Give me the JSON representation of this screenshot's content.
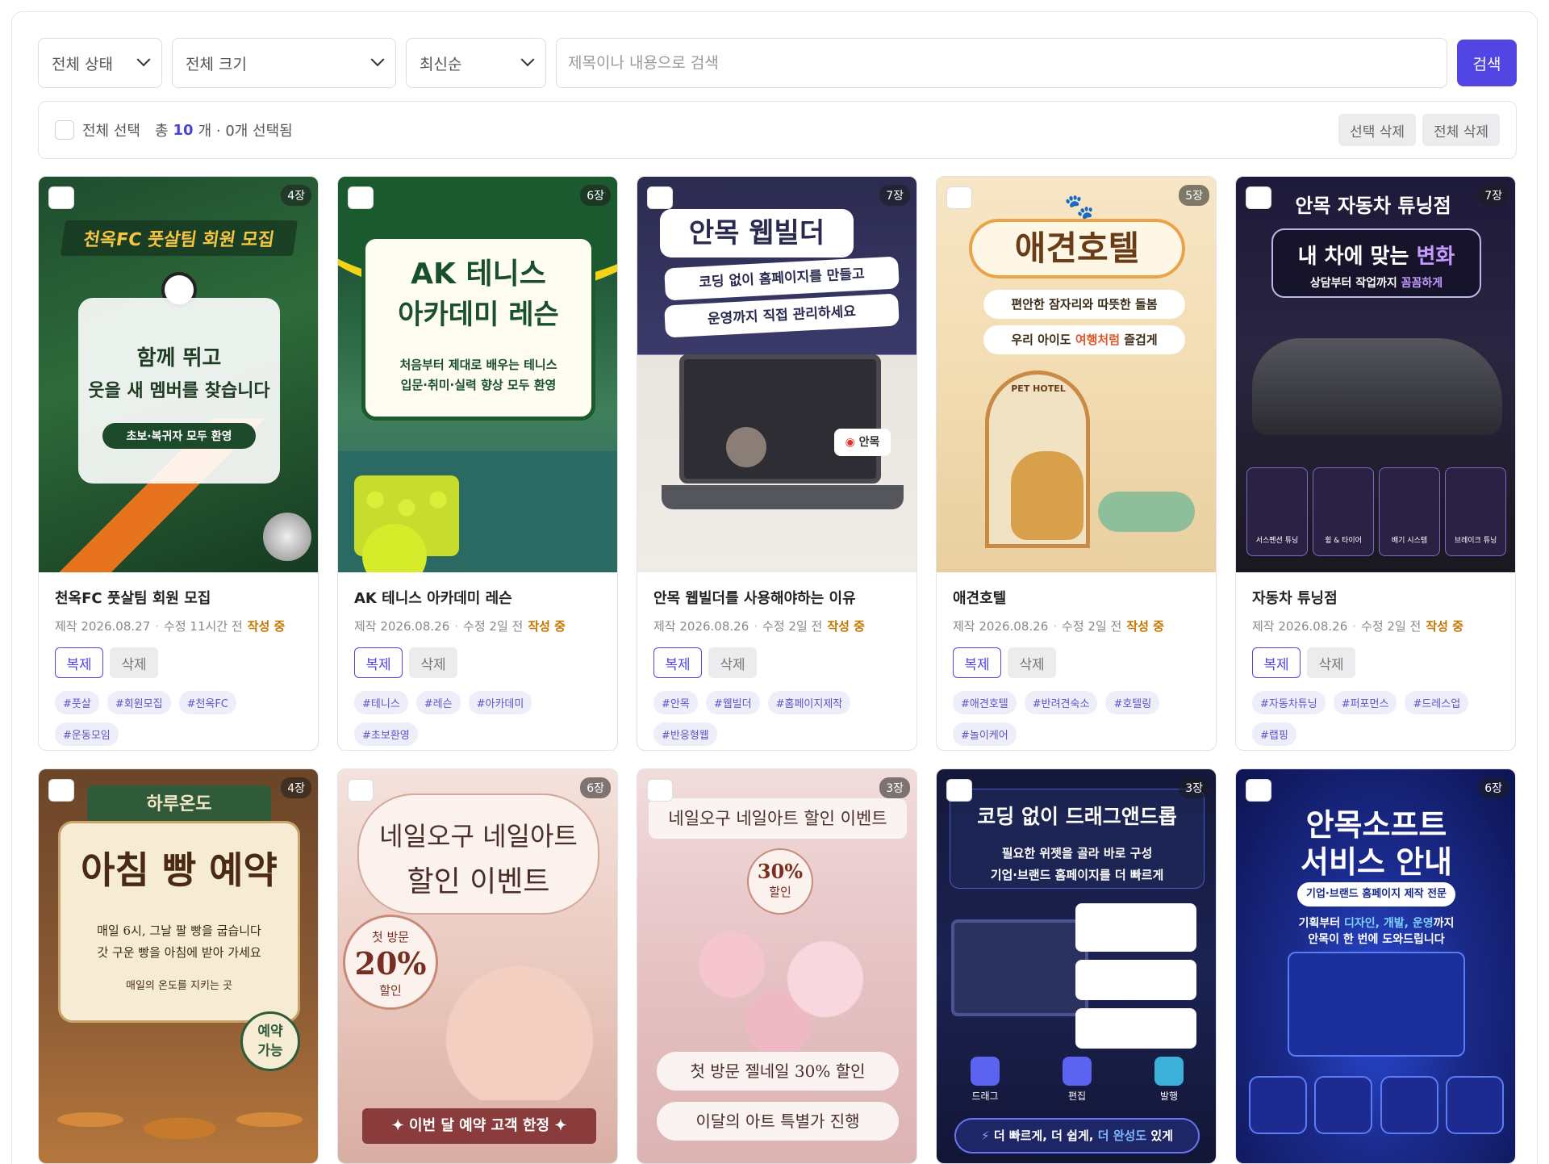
{
  "filters": {
    "status": "전체 상태",
    "size": "전체 크기",
    "sort": "최신순",
    "search_placeholder": "제목이나 내용으로 검색",
    "search_button": "검색"
  },
  "selection": {
    "select_all": "전체 선택",
    "total_prefix": "총",
    "total_count": "10",
    "total_suffix": "개 · 0개 선택됨",
    "delete_selected": "선택 삭제",
    "delete_all": "전체 삭제"
  },
  "colors": {
    "accent": "#5146e4",
    "status": "#c77700"
  },
  "cards": [
    {
      "pages": "4장",
      "title": "천옥FC 풋살팀 회원 모집",
      "made": "제작 2026.08.27",
      "modified": "수정 11시간 전",
      "status": "작성 중",
      "copy": "복제",
      "del": "삭제",
      "tags": [
        "#풋살",
        "#회원모집",
        "#천옥FC",
        "#운동모임"
      ],
      "poster": {
        "headline": "천옥FC 풋살팀 회원 모집",
        "line1": "함께 뛰고",
        "line2": "웃을 새 멤버를 찾습니다",
        "line3": "초보·복귀자 모두 환영"
      }
    },
    {
      "pages": "6장",
      "title": "AK 테니스 아카데미 레슨",
      "made": "제작 2026.08.26",
      "modified": "수정 2일 전",
      "status": "작성 중",
      "copy": "복제",
      "del": "삭제",
      "tags": [
        "#테니스",
        "#레슨",
        "#아카데미",
        "#초보환영"
      ],
      "poster": {
        "headline1": "AK 테니스",
        "headline2": "아카데미 레슨",
        "line1": "처음부터 제대로 배우는 테니스",
        "line2": "입문·취미·실력 향상 모두 환영"
      }
    },
    {
      "pages": "7장",
      "title": "안목 웹빌더를 사용해야하는 이유",
      "made": "제작 2026.08.26",
      "modified": "수정 2일 전",
      "status": "작성 중",
      "copy": "복제",
      "del": "삭제",
      "tags": [
        "#안목",
        "#웹빌더",
        "#홈페이지제작",
        "#반응형웹"
      ],
      "poster": {
        "headline": "안목 웹빌더",
        "line1": "코딩 없이 홈페이지를 만들고",
        "line2": "운영까지 직접 관리하세요",
        "badge": "안목"
      }
    },
    {
      "pages": "5장",
      "title": "애견호텔",
      "made": "제작 2026.08.26",
      "modified": "수정 2일 전",
      "status": "작성 중",
      "copy": "복제",
      "del": "삭제",
      "tags": [
        "#애견호텔",
        "#반려견숙소",
        "#호텔링",
        "#놀이케어"
      ],
      "poster": {
        "headline": "애견호텔",
        "line1": "편안한 잠자리와 따뜻한 돌봄",
        "line2a": "우리 아이도 ",
        "line2b": "여행처럼",
        "line2c": " 즐겁게",
        "sign": "PET HOTEL"
      }
    },
    {
      "pages": "7장",
      "title": "자동차 튜닝점",
      "made": "제작 2026.08.26",
      "modified": "수정 2일 전",
      "status": "작성 중",
      "copy": "복제",
      "del": "삭제",
      "tags": [
        "#자동차튜닝",
        "#퍼포먼스",
        "#드레스업",
        "#랩핑"
      ],
      "poster": {
        "headline": "안목 자동차 튜닝점",
        "line1a": "내 차에 맞는 ",
        "line1b": "변화",
        "line2a": "상담부터 작업까지 ",
        "line2b": "꼼꼼하게",
        "parts": [
          "서스펜션 튜닝",
          "휠 & 타이어",
          "배기 시스템",
          "브레이크 튜닝"
        ]
      }
    },
    {
      "pages": "4장",
      "poster": {
        "top": "하루온도",
        "headline": "아침 빵 예약",
        "line1": "매일 6시, 그날 팔 빵을 굽습니다",
        "line2": "갓 구운 빵을 아침에 받아 가세요",
        "line3": "매일의 온도를 지키는 곳",
        "badge1": "예약",
        "badge2": "가능"
      }
    },
    {
      "pages": "6장",
      "poster": {
        "headline1": "네일오구 네일아트",
        "headline2": "할인 이벤트",
        "badge1": "첫 방문",
        "badge2": "20%",
        "badge3": "할인",
        "ribbon": "✦ 이번 달 예약 고객 한정 ✦"
      }
    },
    {
      "pages": "3장",
      "poster": {
        "headline": "네일오구 네일아트 할인 이벤트",
        "badge1": "30%",
        "badge2": "할인",
        "line1": "첫 방문 젤네일 30% 할인",
        "line2": "이달의 아트 특별가 진행"
      }
    },
    {
      "pages": "3장",
      "poster": {
        "headline": "코딩 없이 드래그앤드롭",
        "line1": "필요한 위젯을 골라 바로 구성",
        "line2": "기업·브랜드 홈페이지를 더 빠르게",
        "step1": "드래그",
        "step2": "편집",
        "step3": "발행",
        "bottom_a": "더 빠르게, 더 쉽게, ",
        "bottom_b": "더 완성도",
        "bottom_c": " 있게"
      }
    },
    {
      "pages": "6장",
      "poster": {
        "headline1": "안목소프트",
        "headline2": "서비스 안내",
        "pill": "기업·브랜드 홈페이지 제작 전문",
        "line1a": "기획부터 ",
        "line1b": "디자인, 개발, 운영",
        "line1c": "까지",
        "line2": "안목이 한 번에 도와드립니다"
      }
    }
  ]
}
